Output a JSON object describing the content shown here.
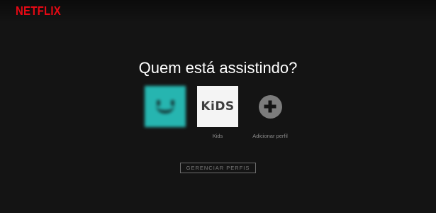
{
  "header": {
    "logo_text": "NETFLIX",
    "logo_color": "#e50914"
  },
  "main": {
    "title": "Quem está assistindo?",
    "profiles": [
      {
        "label": "",
        "avatar_icon": "smiley-face-icon",
        "avatar_color": "#26b5b0",
        "blurred": true
      },
      {
        "label": "Kids",
        "avatar_text": "KiDS",
        "avatar_color": "#f4f4f4"
      },
      {
        "label": "Adicionar perfil",
        "avatar_icon": "plus-circle-icon"
      }
    ],
    "manage_button_label": "GERENCIAR PERFIS"
  },
  "colors": {
    "background": "#141414",
    "accent": "#e50914",
    "muted_text": "#8c8c8c"
  }
}
